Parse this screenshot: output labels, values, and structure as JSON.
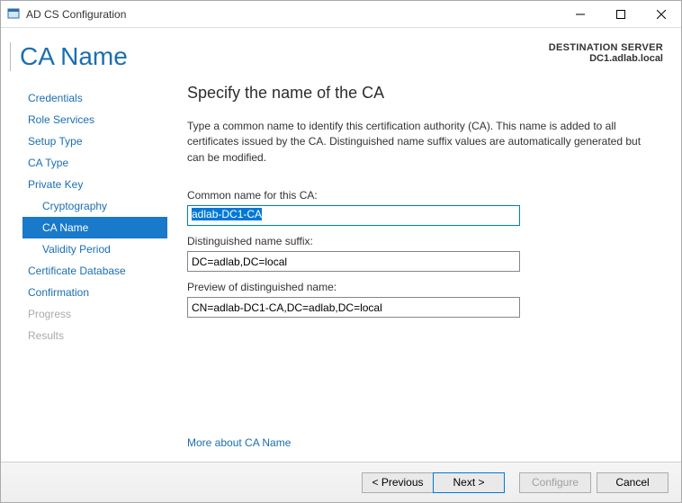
{
  "window": {
    "title": "AD CS Configuration"
  },
  "header": {
    "page_title": "CA Name",
    "destination_label": "DESTINATION SERVER",
    "destination_name": "DC1.adlab.local"
  },
  "sidebar": {
    "items": [
      {
        "label": "Credentials",
        "indent": false,
        "active": false,
        "disabled": false
      },
      {
        "label": "Role Services",
        "indent": false,
        "active": false,
        "disabled": false
      },
      {
        "label": "Setup Type",
        "indent": false,
        "active": false,
        "disabled": false
      },
      {
        "label": "CA Type",
        "indent": false,
        "active": false,
        "disabled": false
      },
      {
        "label": "Private Key",
        "indent": false,
        "active": false,
        "disabled": false
      },
      {
        "label": "Cryptography",
        "indent": true,
        "active": false,
        "disabled": false
      },
      {
        "label": "CA Name",
        "indent": true,
        "active": true,
        "disabled": false
      },
      {
        "label": "Validity Period",
        "indent": true,
        "active": false,
        "disabled": false
      },
      {
        "label": "Certificate Database",
        "indent": false,
        "active": false,
        "disabled": false
      },
      {
        "label": "Confirmation",
        "indent": false,
        "active": false,
        "disabled": false
      },
      {
        "label": "Progress",
        "indent": false,
        "active": false,
        "disabled": true
      },
      {
        "label": "Results",
        "indent": false,
        "active": false,
        "disabled": true
      }
    ]
  },
  "content": {
    "heading": "Specify the name of the CA",
    "description": "Type a common name to identify this certification authority (CA). This name is added to all certificates issued by the CA. Distinguished name suffix values are automatically generated but can be modified.",
    "common_name_label": "Common name for this CA:",
    "common_name_value": "adlab-DC1-CA",
    "dn_suffix_label": "Distinguished name suffix:",
    "dn_suffix_value": "DC=adlab,DC=local",
    "preview_label": "Preview of distinguished name:",
    "preview_value": "CN=adlab-DC1-CA,DC=adlab,DC=local",
    "more_link": "More about CA Name"
  },
  "buttons": {
    "previous": "< Previous",
    "next": "Next >",
    "configure": "Configure",
    "cancel": "Cancel"
  }
}
